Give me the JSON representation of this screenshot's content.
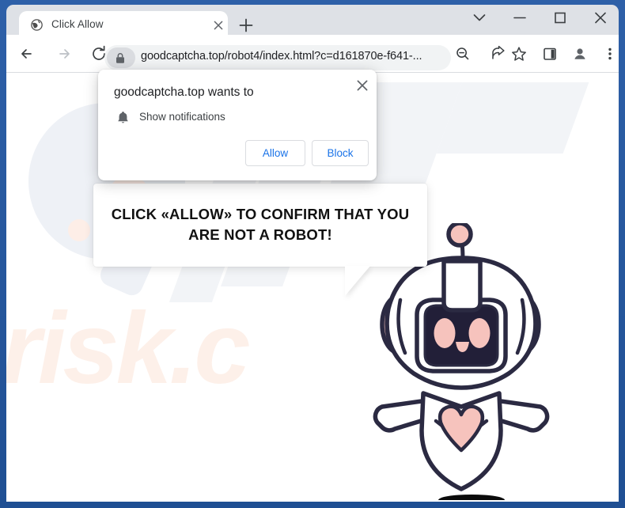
{
  "browser": {
    "tab": {
      "title": "Click Allow",
      "favicon_icon": "globe-icon",
      "close_icon": "close-icon"
    },
    "new_tab_icon": "plus-icon",
    "window_controls": {
      "tab_search_icon": "chevron-down-icon",
      "minimize_icon": "minimize-icon",
      "maximize_icon": "maximize-icon",
      "close_icon": "close-icon"
    },
    "toolbar": {
      "back_icon": "back-arrow-icon",
      "forward_icon": "forward-arrow-icon",
      "reload_icon": "reload-icon",
      "lock_icon": "lock-icon",
      "url": "goodcaptcha.top/robot4/index.html?c=d161870e-f641-...",
      "zoom_out_icon": "zoom-out-icon",
      "share_icon": "share-icon",
      "bookmark_icon": "star-icon",
      "side_panel_icon": "side-panel-icon",
      "profile_icon": "profile-avatar-icon",
      "menu_icon": "three-dot-menu-icon"
    }
  },
  "dialog": {
    "title": "goodcaptcha.top wants to",
    "permission": "Show notifications",
    "permission_icon": "bell-icon",
    "close_icon": "close-icon",
    "allow_label": "Allow",
    "block_label": "Block"
  },
  "page": {
    "bubble_line1": "CLICK «ALLOW» TO CONFIRM THAT YOU",
    "bubble_line2": "ARE NOT A ROBOT!",
    "watermark_text": "risk.c",
    "robot_name": "robot-mascot-illustration"
  },
  "colors": {
    "window_frame": "#2b5ea7",
    "tabstrip": "#dee1e6",
    "omnibox": "#f1f3f4",
    "link_blue": "#1a73e8",
    "robot_outline": "#2b2a42",
    "robot_pink": "#f6c3bd",
    "robot_screen": "#221f38",
    "watermark_peach": "#fdf0e9",
    "watermark_blue": "#eef1f6"
  }
}
